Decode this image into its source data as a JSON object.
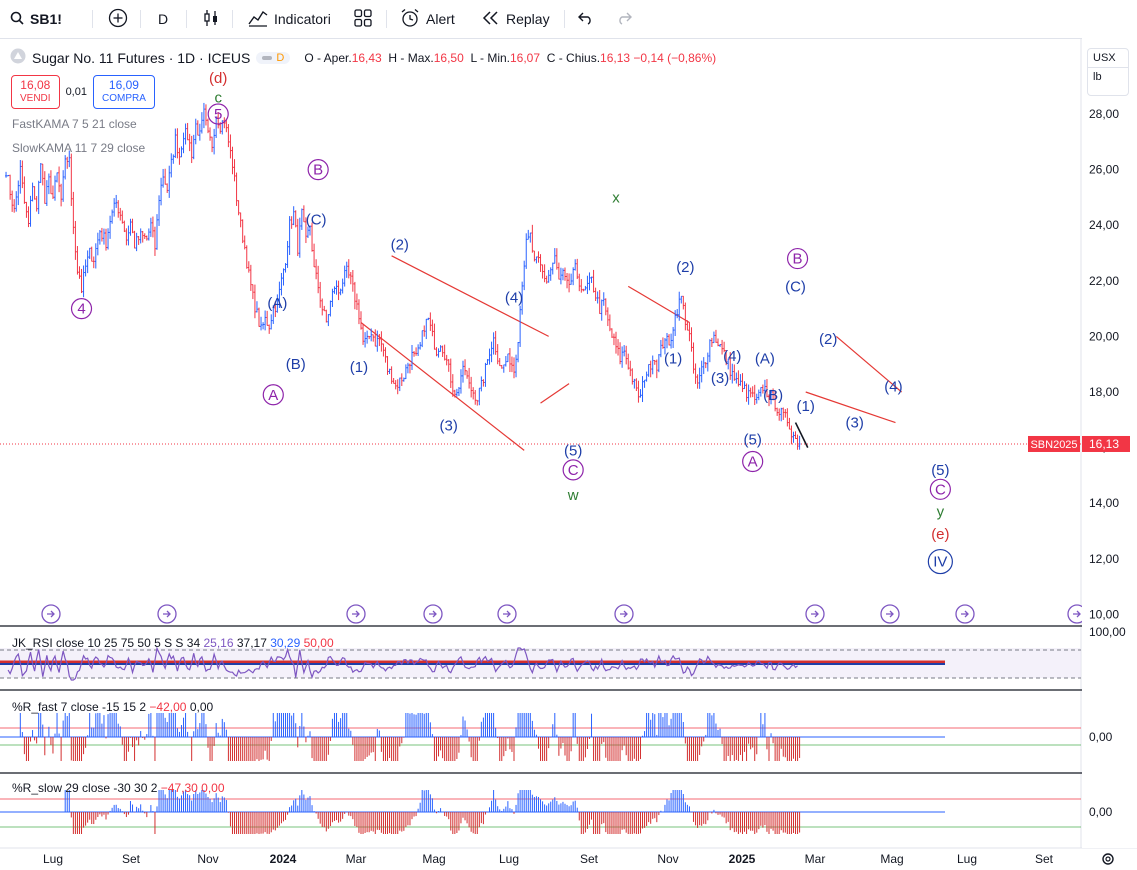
{
  "toolbar": {
    "symbol": "SB1!",
    "interval": "D",
    "indicators_label": "Indicatori",
    "alert_label": "Alert",
    "replay_label": "Replay"
  },
  "legend": {
    "title": "Sugar No. 11 Futures · 1D · ICEUS",
    "badge": "D",
    "open_label": "O - Aper.",
    "open": "16,43",
    "high_label": "H - Max.",
    "high": "16,50",
    "low_label": "L - Min.",
    "low": "16,07",
    "close_label": "C - Chius.",
    "close": "16,13",
    "change": "−0,14 (−0,86%)"
  },
  "trade": {
    "sell_price": "16,08",
    "sell_label": "VENDI",
    "spread": "0,01",
    "buy_price": "16,09",
    "buy_label": "COMPRA"
  },
  "indicators": {
    "fast_kama": "FastKAMA 7 5 21 close",
    "slow_kama": "SlowKAMA 11 7 29 close"
  },
  "panes": {
    "rsi_label": "JK_RSI close 10 25 75 50 5 S S 34",
    "rsi_values": [
      "25,16",
      "37,17",
      "30,29",
      "50,00"
    ],
    "rsi_value_colors": [
      "#7e57c2",
      "#131722",
      "#2962ff",
      "#f23645"
    ],
    "rsi_axis": "100,00",
    "wr_fast_label": "%R_fast 7 close -15 15 2",
    "wr_fast_values": [
      "−42,00",
      "0,00"
    ],
    "wr_fast_axis": "0,00",
    "wr_slow_label": "%R_slow 29 close -30 30 2",
    "wr_slow_values": [
      "−47,30",
      "0,00"
    ],
    "wr_slow_axis": "0,00"
  },
  "price_axis": {
    "unit": "USX",
    "unit2": "lb",
    "ticks": [
      "28,00",
      "26,00",
      "24,00",
      "22,00",
      "20,00",
      "18,00",
      "16,00",
      "14,00",
      "12,00",
      "10,00"
    ],
    "last_symbol": "SBN2025",
    "last_price": "16,13"
  },
  "time_axis": [
    "Lug",
    "Set",
    "Nov",
    "2024",
    "Mar",
    "Mag",
    "Lug",
    "Set",
    "Nov",
    "2025",
    "Mar",
    "Mag",
    "Lug",
    "Set"
  ],
  "colors": {
    "up": "#2962ff",
    "down": "#f23645",
    "wave_blue": "#1e3ea8",
    "wave_purple": "#8e24aa",
    "wave_green": "#2e7d32",
    "wave_red": "#d32f2f",
    "trendline": "#e53935"
  },
  "chart_data": {
    "type": "candlestick",
    "title": "Sugar No. 11 Futures · 1D · ICEUS",
    "xlabel": "",
    "ylabel": "",
    "ylim": [
      10,
      28.5
    ],
    "x_period": [
      "2023-06",
      "2025-09"
    ],
    "path": [
      [
        1,
        26.0
      ],
      [
        3,
        25.2
      ],
      [
        5,
        24.5
      ],
      [
        8,
        26.0
      ],
      [
        10,
        24.8
      ],
      [
        12,
        24.0
      ],
      [
        14,
        25.5
      ],
      [
        16,
        24.5
      ],
      [
        18,
        26.4
      ],
      [
        20,
        24.8
      ],
      [
        22,
        25.6
      ],
      [
        24,
        25.0
      ],
      [
        26,
        25.8
      ],
      [
        28,
        24.9
      ],
      [
        30,
        26.2
      ],
      [
        32,
        26.5
      ],
      [
        33,
        24.8
      ],
      [
        34,
        24.0
      ],
      [
        36,
        22.4
      ],
      [
        37,
        22.2
      ],
      [
        38,
        21.7
      ],
      [
        40,
        22.5
      ],
      [
        42,
        23.0
      ],
      [
        44,
        22.8
      ],
      [
        47,
        23.8
      ],
      [
        50,
        23.4
      ],
      [
        52,
        24.2
      ],
      [
        55,
        24.8
      ],
      [
        58,
        24.2
      ],
      [
        60,
        23.5
      ],
      [
        62,
        24.1
      ],
      [
        64,
        23.3
      ],
      [
        67,
        23.6
      ],
      [
        70,
        23.5
      ],
      [
        72,
        24.0
      ],
      [
        74,
        23.2
      ],
      [
        76,
        25.0
      ],
      [
        78,
        25.8
      ],
      [
        80,
        25.3
      ],
      [
        82,
        26.2
      ],
      [
        84,
        27.1
      ],
      [
        86,
        26.5
      ],
      [
        88,
        27.3
      ],
      [
        90,
        27.2
      ],
      [
        92,
        26.6
      ],
      [
        94,
        27.6
      ],
      [
        96,
        27.2
      ],
      [
        98,
        28.0
      ],
      [
        100,
        27.2
      ],
      [
        102,
        26.9
      ],
      [
        104,
        28.0
      ],
      [
        106,
        27.6
      ],
      [
        108,
        27.8
      ],
      [
        110,
        27.0
      ],
      [
        112,
        26.2
      ],
      [
        114,
        25.0
      ],
      [
        116,
        24.0
      ],
      [
        118,
        23.2
      ],
      [
        120,
        22.2
      ],
      [
        122,
        21.4
      ],
      [
        124,
        20.8
      ],
      [
        126,
        20.2
      ],
      [
        128,
        20.6
      ],
      [
        130,
        20.4
      ],
      [
        132,
        21.0
      ],
      [
        134,
        21.2
      ],
      [
        136,
        22.0
      ],
      [
        138,
        22.8
      ],
      [
        140,
        24.0
      ],
      [
        142,
        24.4
      ],
      [
        144,
        23.2
      ],
      [
        146,
        24.4
      ],
      [
        148,
        23.4
      ],
      [
        150,
        24.0
      ],
      [
        152,
        22.4
      ],
      [
        154,
        21.8
      ],
      [
        156,
        21.0
      ],
      [
        158,
        20.5
      ],
      [
        160,
        21.2
      ],
      [
        162,
        21.8
      ],
      [
        164,
        21.6
      ],
      [
        166,
        22.0
      ],
      [
        168,
        22.3
      ],
      [
        170,
        22.0
      ],
      [
        172,
        21.4
      ],
      [
        174,
        20.8
      ],
      [
        176,
        19.8
      ],
      [
        178,
        19.8
      ],
      [
        180,
        20.2
      ],
      [
        182,
        19.8
      ],
      [
        184,
        19.9
      ],
      [
        186,
        19.5
      ],
      [
        188,
        18.8
      ],
      [
        190,
        18.6
      ],
      [
        192,
        18.2
      ],
      [
        194,
        18.4
      ],
      [
        196,
        18.6
      ],
      [
        198,
        19.0
      ],
      [
        200,
        19.3
      ],
      [
        202,
        19.2
      ],
      [
        204,
        19.6
      ],
      [
        206,
        20.4
      ],
      [
        208,
        20.6
      ],
      [
        210,
        20.0
      ],
      [
        212,
        19.5
      ],
      [
        214,
        19.8
      ],
      [
        216,
        19.4
      ],
      [
        218,
        18.8
      ],
      [
        220,
        18.2
      ],
      [
        222,
        17.9
      ],
      [
        224,
        18.6
      ],
      [
        226,
        18.8
      ],
      [
        228,
        18.2
      ],
      [
        230,
        18.0
      ],
      [
        232,
        17.8
      ],
      [
        234,
        18.2
      ],
      [
        236,
        18.8
      ],
      [
        238,
        19.5
      ],
      [
        240,
        19.9
      ],
      [
        242,
        19.3
      ],
      [
        244,
        18.8
      ],
      [
        246,
        19.1
      ],
      [
        248,
        19.2
      ],
      [
        250,
        18.8
      ],
      [
        252,
        20.0
      ],
      [
        254,
        22.0
      ],
      [
        256,
        23.3
      ],
      [
        258,
        23.6
      ],
      [
        260,
        22.6
      ],
      [
        262,
        22.7
      ],
      [
        264,
        22.3
      ],
      [
        266,
        22.0
      ],
      [
        268,
        22.4
      ],
      [
        270,
        22.8
      ],
      [
        272,
        22.0
      ],
      [
        274,
        22.2
      ],
      [
        276,
        21.8
      ],
      [
        278,
        22.0
      ],
      [
        280,
        22.4
      ],
      [
        282,
        22.0
      ],
      [
        284,
        21.5
      ],
      [
        286,
        21.8
      ],
      [
        288,
        22.0
      ],
      [
        290,
        21.5
      ],
      [
        292,
        21.0
      ],
      [
        294,
        21.2
      ],
      [
        296,
        20.5
      ],
      [
        298,
        20.0
      ],
      [
        300,
        19.6
      ],
      [
        302,
        19.2
      ],
      [
        304,
        19.5
      ],
      [
        306,
        19.0
      ],
      [
        308,
        18.5
      ],
      [
        310,
        18.0
      ],
      [
        312,
        17.8
      ],
      [
        314,
        18.6
      ],
      [
        316,
        18.8
      ],
      [
        318,
        19.3
      ],
      [
        320,
        19.0
      ],
      [
        322,
        19.5
      ],
      [
        324,
        20.0
      ],
      [
        326,
        19.6
      ],
      [
        328,
        20.4
      ],
      [
        330,
        21.0
      ],
      [
        332,
        21.4
      ],
      [
        334,
        20.6
      ],
      [
        336,
        20.0
      ],
      [
        338,
        18.8
      ],
      [
        340,
        18.2
      ],
      [
        342,
        18.8
      ],
      [
        344,
        19.2
      ],
      [
        346,
        19.8
      ],
      [
        348,
        20.0
      ],
      [
        350,
        19.8
      ],
      [
        352,
        19.5
      ],
      [
        354,
        19.2
      ],
      [
        356,
        18.8
      ],
      [
        358,
        18.5
      ],
      [
        360,
        18.2
      ],
      [
        362,
        18.3
      ],
      [
        364,
        17.8
      ],
      [
        366,
        18.0
      ],
      [
        368,
        17.6
      ],
      [
        370,
        17.8
      ],
      [
        372,
        18.2
      ],
      [
        374,
        18.0
      ],
      [
        376,
        17.8
      ],
      [
        378,
        17.6
      ],
      [
        380,
        17.3
      ],
      [
        382,
        17.1
      ],
      [
        384,
        17.0
      ],
      [
        386,
        16.6
      ],
      [
        388,
        16.3
      ],
      [
        390,
        16.13
      ]
    ],
    "price_labels": [
      "28,00",
      "26,00",
      "24,00",
      "22,00",
      "20,00",
      "18,00",
      "16,00",
      "14,00",
      "12,00",
      "10,00"
    ],
    "last_price": 16.13,
    "wave_labels": [
      {
        "t": "(d)",
        "day": 105,
        "p": 29.3,
        "c": "red"
      },
      {
        "t": "c",
        "day": 105,
        "p": 28.6,
        "c": "green"
      },
      {
        "t": "5",
        "day": 105,
        "p": 28.0,
        "c": "purple",
        "circle": true
      },
      {
        "t": "4",
        "day": 38,
        "p": 21.0,
        "c": "purple",
        "circle": true
      },
      {
        "t": "B",
        "day": 154,
        "p": 26.0,
        "c": "purple",
        "circle": true
      },
      {
        "t": "(C)",
        "day": 153,
        "p": 24.2,
        "c": "blue"
      },
      {
        "t": "(A)",
        "day": 134,
        "p": 21.2,
        "c": "blue"
      },
      {
        "t": "(B)",
        "day": 143,
        "p": 19.0,
        "c": "blue"
      },
      {
        "t": "A",
        "day": 132,
        "p": 17.9,
        "c": "purple",
        "circle": true
      },
      {
        "t": "(2)",
        "day": 194,
        "p": 23.3,
        "c": "blue"
      },
      {
        "t": "(1)",
        "day": 174,
        "p": 18.9,
        "c": "blue"
      },
      {
        "t": "(3)",
        "day": 218,
        "p": 16.8,
        "c": "blue"
      },
      {
        "t": "(4)",
        "day": 250,
        "p": 21.4,
        "c": "blue"
      },
      {
        "t": "(5)",
        "day": 279,
        "p": 15.9,
        "c": "blue"
      },
      {
        "t": "C",
        "day": 279,
        "p": 15.2,
        "c": "purple",
        "circle": true
      },
      {
        "t": "w",
        "day": 279,
        "p": 14.3,
        "c": "green"
      },
      {
        "t": "x",
        "day": 300,
        "p": 25.0,
        "c": "green"
      },
      {
        "t": "(2)",
        "day": 334,
        "p": 22.5,
        "c": "blue"
      },
      {
        "t": "(1)",
        "day": 328,
        "p": 19.2,
        "c": "blue"
      },
      {
        "t": "(4)",
        "day": 357,
        "p": 19.3,
        "c": "blue"
      },
      {
        "t": "(A)",
        "day": 373,
        "p": 19.2,
        "c": "blue"
      },
      {
        "t": "(3)",
        "day": 351,
        "p": 18.5,
        "c": "blue"
      },
      {
        "t": "(B)",
        "day": 377,
        "p": 17.9,
        "c": "blue"
      },
      {
        "t": "(5)",
        "day": 367,
        "p": 16.3,
        "c": "blue"
      },
      {
        "t": "A",
        "day": 367,
        "p": 15.5,
        "c": "purple",
        "circle": true
      },
      {
        "t": "B",
        "day": 389,
        "p": 22.8,
        "c": "purple",
        "circle": true
      },
      {
        "t": "(C)",
        "day": 388,
        "p": 21.8,
        "c": "blue"
      },
      {
        "t": "(2)",
        "day": 404,
        "p": 19.9,
        "c": "blue"
      },
      {
        "t": "(1)",
        "day": 393,
        "p": 17.5,
        "c": "blue"
      },
      {
        "t": "(3)",
        "day": 417,
        "p": 16.9,
        "c": "blue"
      },
      {
        "t": "(4)",
        "day": 436,
        "p": 18.2,
        "c": "blue"
      },
      {
        "t": "(5)",
        "day": 459,
        "p": 15.2,
        "c": "blue"
      },
      {
        "t": "C",
        "day": 459,
        "p": 14.5,
        "c": "purple",
        "circle": true
      },
      {
        "t": "y",
        "day": 459,
        "p": 13.7,
        "c": "green"
      },
      {
        "t": "(e)",
        "day": 459,
        "p": 12.9,
        "c": "red"
      },
      {
        "t": "IV",
        "day": 459,
        "p": 11.9,
        "c": "blue",
        "circle": true
      }
    ],
    "trendlines": [
      {
        "d1": 175,
        "p1": 20.5,
        "d2": 255,
        "p2": 15.9
      },
      {
        "d1": 190,
        "p1": 22.9,
        "d2": 267,
        "p2": 20.0
      },
      {
        "d1": 263,
        "p1": 17.6,
        "d2": 277,
        "p2": 18.3
      },
      {
        "d1": 306,
        "p1": 21.8,
        "d2": 336,
        "p2": 20.5
      },
      {
        "d1": 393,
        "p1": 18.0,
        "d2": 437,
        "p2": 16.9
      },
      {
        "d1": 408,
        "p1": 20.0,
        "d2": 440,
        "p2": 18.0
      }
    ]
  }
}
